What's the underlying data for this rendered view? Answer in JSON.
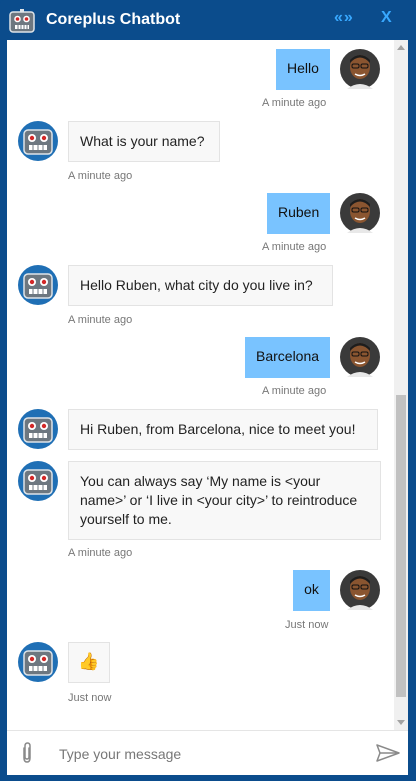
{
  "window": {
    "title": "Coreplus Chatbot",
    "collapse_label": "«»",
    "close_label": "X"
  },
  "messages": [
    {
      "sender": "user",
      "text": "Hello",
      "time": "A minute ago"
    },
    {
      "sender": "bot",
      "text": "What is your name?",
      "time": "A minute ago"
    },
    {
      "sender": "user",
      "text": "Ruben",
      "time": "A minute ago"
    },
    {
      "sender": "bot",
      "text": "Hello Ruben, what city do you live in?",
      "time": "A minute ago"
    },
    {
      "sender": "user",
      "text": "Barcelona",
      "time": "A minute ago"
    },
    {
      "sender": "bot",
      "text": "Hi Ruben, from Barcelona, nice to meet you!",
      "time": ""
    },
    {
      "sender": "bot",
      "text": "You can always say ‘My name is <your name>’ or ‘I live in <your city>’ to reintroduce yourself to me.",
      "time": "A minute ago"
    },
    {
      "sender": "user",
      "text": "ok",
      "time": "Just now"
    },
    {
      "sender": "bot",
      "text": "👍",
      "time": "Just now"
    }
  ],
  "input": {
    "placeholder": "Type your message"
  },
  "icons": {
    "bot_avatar": "robot-icon",
    "user_avatar": "user-photo",
    "attach": "paperclip-icon",
    "send": "send-icon"
  },
  "colors": {
    "header": "#0b4c8c",
    "accent": "#38a8ff",
    "user_bubble": "#79c3ff",
    "bot_bubble": "#f8f8f8"
  }
}
